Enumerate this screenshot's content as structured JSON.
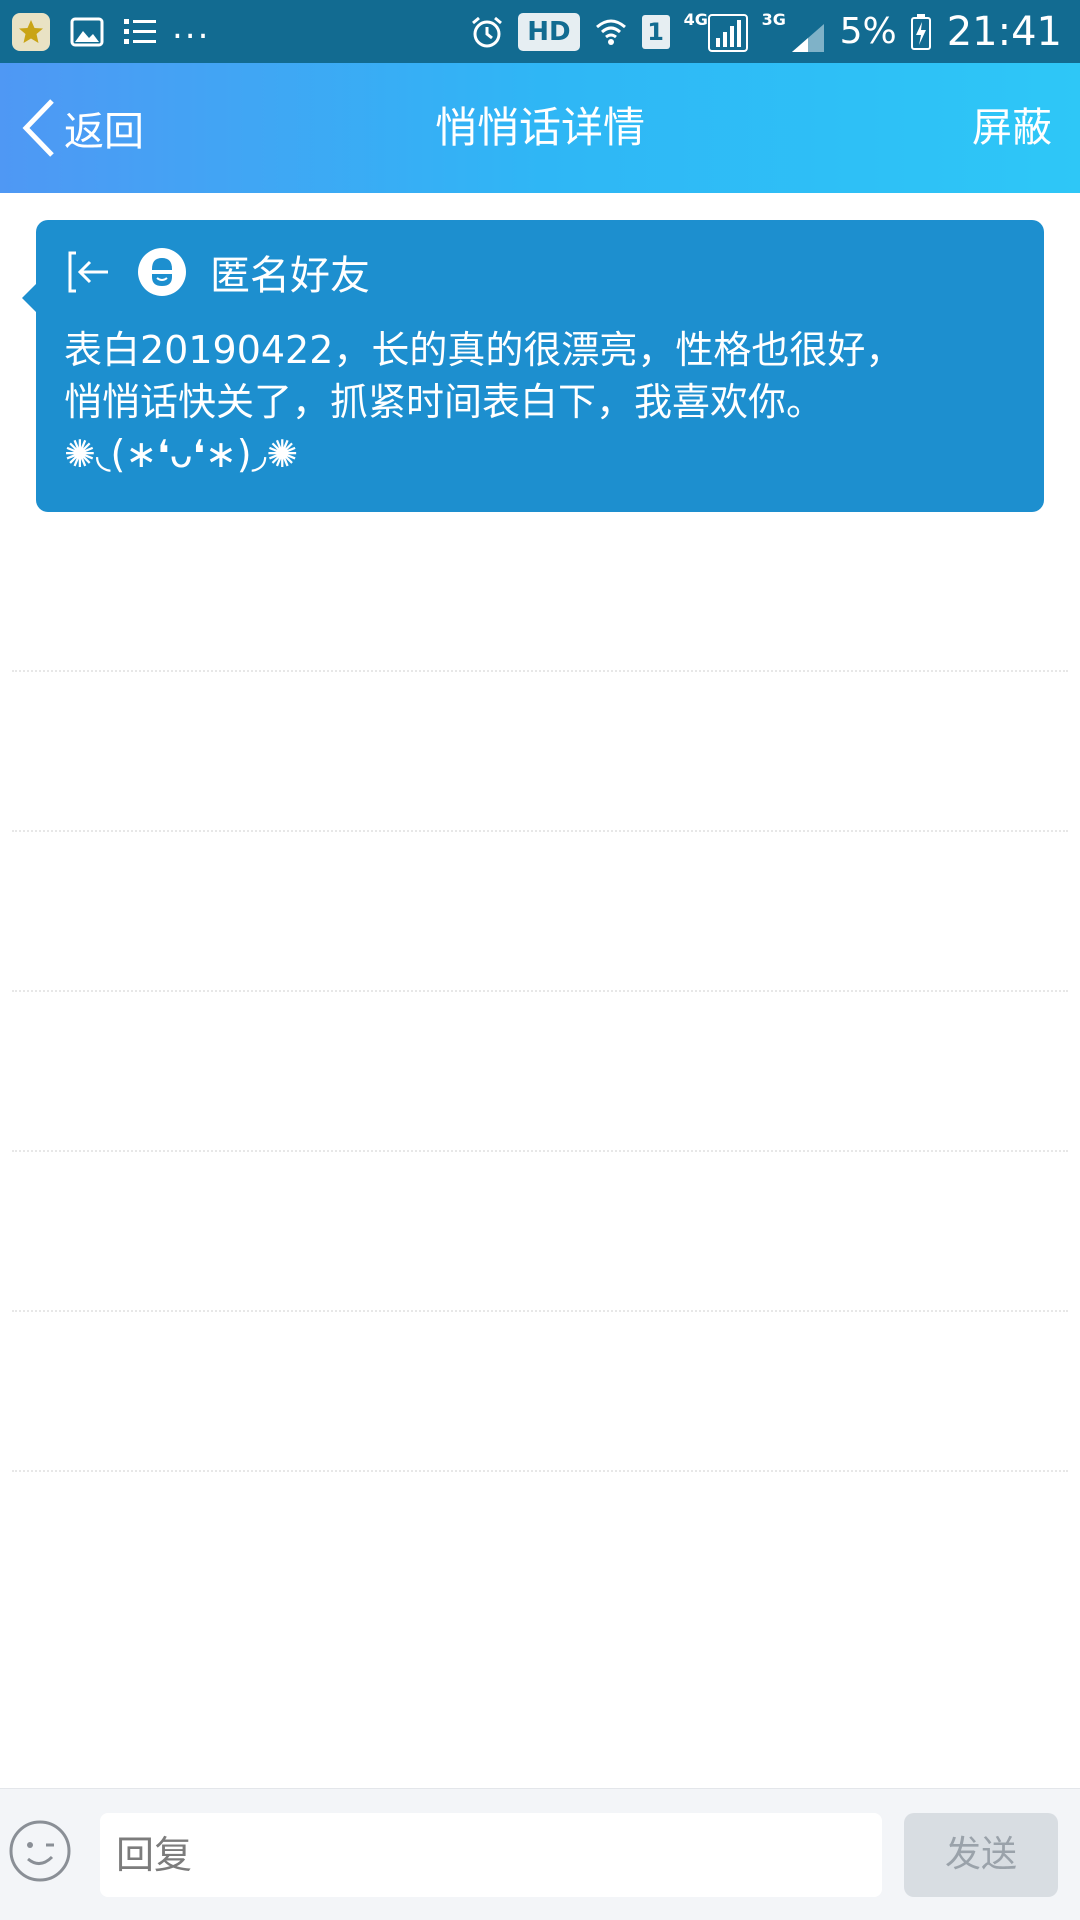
{
  "status_bar": {
    "more": "...",
    "hd": "HD",
    "sim": "1",
    "net1": "4G",
    "net2": "3G",
    "battery": "5%",
    "time": "21:41",
    "icons": [
      "app-star-icon",
      "gallery-icon",
      "list-icon",
      "alarm-icon",
      "wifi-icon",
      "signal-icon",
      "battery-charging-icon"
    ]
  },
  "header": {
    "back_label": "返回",
    "title": "悄悄话详情",
    "block_label": "屏蔽",
    "gradient": [
      "#4f98f4",
      "#2ec7f7"
    ]
  },
  "message": {
    "sender": "匿名好友",
    "text": "表白20190422，长的真的很漂亮，性格也很好，\n悄悄话快关了，抓紧时间表白下，我喜欢你。\n✺◟(∗❛ᴗ❛∗)◞✺",
    "card_color": "#1d8fcf"
  },
  "composer": {
    "placeholder": "回复",
    "value": "",
    "send_label": "发送"
  }
}
